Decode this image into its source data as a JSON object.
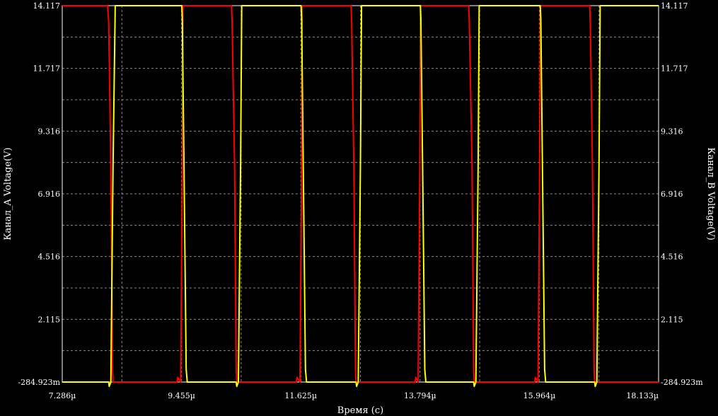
{
  "chart_data": {
    "type": "line",
    "xlabel": "Время (с)",
    "ylabel_left": "Канал_A Voltage(V)",
    "ylabel_right": "Канал_B Voltage(V)",
    "x_unit": "µs",
    "x_ticks": [
      "7.286µ",
      "9.455µ",
      "11.625µ",
      "13.794µ",
      "15.964µ",
      "18.133µ"
    ],
    "x_tick_values": [
      7.286,
      9.455,
      11.625,
      13.794,
      15.964,
      18.133
    ],
    "y_ticks": [
      "-284.923m",
      "2.115",
      "4.516",
      "6.916",
      "9.316",
      "11.717",
      "14.117"
    ],
    "y_tick_values": [
      -0.284923,
      2.115,
      4.516,
      6.916,
      9.316,
      11.717,
      14.117
    ],
    "xlim": [
      7.286,
      18.133
    ],
    "ylim": [
      -0.284923,
      14.117
    ],
    "grid": true,
    "series": [
      {
        "color": "#ff0000",
        "x": [
          7.286,
          8.11,
          8.13,
          8.17,
          8.2,
          8.21,
          9.375,
          9.385,
          9.44,
          9.47,
          9.48,
          10.365,
          10.375,
          10.42,
          10.45,
          10.46,
          11.545,
          11.555,
          11.61,
          11.64,
          11.65,
          12.54,
          12.55,
          12.59,
          12.62,
          12.63,
          13.705,
          13.715,
          13.76,
          13.79,
          13.8,
          14.68,
          14.69,
          14.74,
          14.77,
          14.78,
          15.88,
          15.89,
          15.94,
          15.97,
          15.98,
          16.88,
          16.89,
          16.93,
          16.96,
          16.97,
          18.133
        ],
        "values": [
          14.117,
          14.117,
          13.5,
          8.0,
          0.2,
          -0.284923,
          -0.284923,
          -0.1,
          -0.284923,
          8.0,
          14.117,
          14.117,
          13.5,
          8.0,
          0.2,
          -0.284923,
          -0.284923,
          -0.1,
          -0.284923,
          8.0,
          14.117,
          14.117,
          13.5,
          8.0,
          0.2,
          -0.284923,
          -0.284923,
          -0.1,
          -0.284923,
          8.0,
          14.117,
          14.117,
          13.5,
          8.0,
          0.2,
          -0.284923,
          -0.284923,
          -0.1,
          -0.284923,
          8.0,
          14.117,
          14.117,
          13.5,
          8.0,
          0.2,
          -0.284923,
          -0.284923
        ]
      },
      {
        "color": "#ffff00",
        "x": [
          7.286,
          8.13,
          8.14,
          8.17,
          8.21,
          8.25,
          9.46,
          9.47,
          9.5,
          9.54,
          9.56,
          10.45,
          10.46,
          10.49,
          10.53,
          10.55,
          11.63,
          11.64,
          11.67,
          11.71,
          11.73,
          12.63,
          12.64,
          12.67,
          12.71,
          12.73,
          13.8,
          13.81,
          13.84,
          13.88,
          13.9,
          14.77,
          14.78,
          14.81,
          14.85,
          14.87,
          15.98,
          15.99,
          16.02,
          16.06,
          16.08,
          16.97,
          16.98,
          17.01,
          17.05,
          17.07,
          18.133
        ],
        "values": [
          -0.284923,
          -0.284923,
          -0.45,
          -0.284923,
          8.0,
          14.117,
          14.117,
          13.6,
          8.0,
          0.2,
          -0.284923,
          -0.284923,
          -0.45,
          -0.284923,
          8.0,
          14.117,
          14.117,
          13.6,
          8.0,
          0.2,
          -0.284923,
          -0.284923,
          -0.45,
          -0.284923,
          8.0,
          14.117,
          14.117,
          13.6,
          8.0,
          0.2,
          -0.284923,
          -0.284923,
          -0.45,
          -0.284923,
          8.0,
          14.117,
          14.117,
          13.6,
          8.0,
          0.2,
          -0.284923,
          -0.284923,
          -0.45,
          -0.284923,
          8.0,
          14.117,
          14.117
        ]
      }
    ]
  }
}
